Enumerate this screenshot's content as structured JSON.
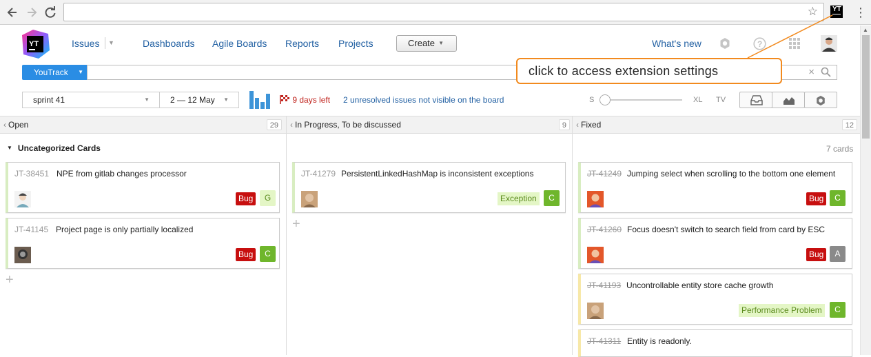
{
  "browser": {
    "back_icon": "arrow-left",
    "forward_icon": "arrow-right",
    "reload_icon": "reload",
    "url": "",
    "extension_label": "YT",
    "menu_icon": "⋮"
  },
  "header": {
    "logo_text": "YT",
    "nav": {
      "issues": "Issues",
      "dashboards": "Dashboards",
      "agile_boards": "Agile Boards",
      "reports": "Reports",
      "projects": "Projects",
      "whats_new": "What's new"
    },
    "create_label": "Create"
  },
  "search": {
    "context_label": "YouTrack",
    "value": "",
    "clear_icon": "×"
  },
  "toolbar": {
    "sprint": "sprint 41",
    "dates": "2 — 12 May",
    "days_left": "9 days left",
    "unresolved": "2 unresolved issues not visible on the board",
    "size_s": "S",
    "size_xl": "XL",
    "size_tv": "TV"
  },
  "columns": [
    {
      "name": "Open",
      "count": "29"
    },
    {
      "name": "In Progress, To be discussed",
      "count": "9"
    },
    {
      "name": "Fixed",
      "count": "12"
    }
  ],
  "swimlane": {
    "title": "Uncategorized Cards",
    "count_label": "7 cards"
  },
  "cards": {
    "open": [
      {
        "id": "JT-38451",
        "title": "NPE from gitlab changes processor",
        "type": "Bug",
        "assignee": "G"
      },
      {
        "id": "JT-41145",
        "title": "Project page is only partially localized",
        "type": "Bug",
        "assignee": "C"
      }
    ],
    "in_progress": [
      {
        "id": "JT-41279",
        "title": "PersistentLinkedHashMap is inconsistent exceptions",
        "type": "Exception",
        "assignee": "C"
      }
    ],
    "fixed": [
      {
        "id": "JT-41249",
        "title": "Jumping select when scrolling to the bottom one element",
        "type": "Bug",
        "assignee": "C"
      },
      {
        "id": "JT-41260",
        "title": "Focus doesn't switch to search field from card by ESC",
        "type": "Bug",
        "assignee": "A"
      },
      {
        "id": "JT-41193",
        "title": "Uncontrollable entity store cache growth",
        "type": "Performance Problem",
        "assignee": "C"
      },
      {
        "id": "JT-41311",
        "title": "Entity is readonly."
      }
    ]
  },
  "callout": {
    "text": "click to access extension settings"
  },
  "colors": {
    "accent": "#2a8de4",
    "link": "#2361a3",
    "bug": "#c70f0f",
    "callout_border": "#f28a1e",
    "assignee_green": "#6fb62c"
  }
}
